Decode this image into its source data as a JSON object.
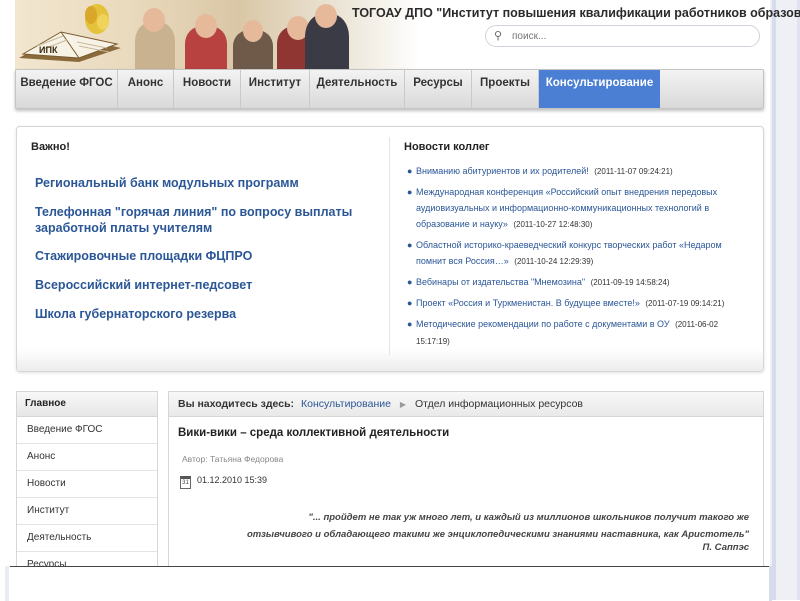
{
  "header": {
    "org_title": "ТОГОАУ ДПО \"Институт повышения квалификации работников образования\"",
    "logo_text": "ИПК"
  },
  "search": {
    "placeholder": "поиск..."
  },
  "nav": {
    "items": [
      {
        "label": "Введение ФГОС",
        "active": false
      },
      {
        "label": "Анонс",
        "active": false
      },
      {
        "label": "Новости",
        "active": false
      },
      {
        "label": "Институт",
        "active": false
      },
      {
        "label": "Деятельность",
        "active": false
      },
      {
        "label": "Ресурсы",
        "active": false
      },
      {
        "label": "Проекты",
        "active": false
      },
      {
        "label": "Консультирование",
        "active": true
      }
    ]
  },
  "important": {
    "title": "Важно!",
    "links": [
      "Региональный банк модульных программ",
      "Телефонная \"горячая линия\" по вопросу выплаты заработной платы учителям",
      "Стажировочные площадки ФЦПРО",
      "Всероссийский интернет-педсовет",
      "Школа губернаторского резерва"
    ]
  },
  "colleague_news": {
    "title": "Новости коллег",
    "items": [
      {
        "text": "Вниманию абитуриентов и их родителей!",
        "date": "(2011-11-07 09:24:21)"
      },
      {
        "text": "Международная конференция «Российский опыт внедрения передовых аудиовизуальных и информационно-коммуникационных технологий в образование и науку»",
        "date": "(2011-10-27 12:48:30)"
      },
      {
        "text": "Областной историко-краеведческий конкурс творческих работ «Недаром помнит вся Россия…»",
        "date": "(2011-10-24 12:29:39)"
      },
      {
        "text": "Вебинары от издательства \"Мнемозина\"",
        "date": "(2011-09-19 14:58:24)"
      },
      {
        "text": "Проект «Россия и Туркменистан. В будущее вместе!»",
        "date": "(2011-07-19 09:14:21)"
      },
      {
        "text": "Методические рекомендации по работе с документами в ОУ",
        "date": "(2011-06-02 15:17:19)"
      }
    ]
  },
  "side_menu": {
    "title": "Главное",
    "items": [
      "Введение ФГОС",
      "Анонс",
      "Новости",
      "Институт",
      "Деятельность",
      "Ресурсы"
    ]
  },
  "breadcrumb": {
    "label": "Вы находитесь здесь:",
    "link": "Консультирование",
    "current": "Отдел информационных ресурсов"
  },
  "article": {
    "title": "Вики-вики – среда коллективной деятельности",
    "author": "Автор: Татьяна Федорова",
    "date": "01.12.2010 15:39",
    "quote_line1": "\"... пройдет не так уж много лет, и каждый из миллионов школьников получит такого же",
    "quote_line2": "отзывчивого и обладающего такими же энциклопедическими знаниями наставника, как Аристотель\"",
    "quote_author": "П. Саппэс"
  },
  "colors": {
    "accent": "#4a7fd3",
    "link": "#2b5797"
  }
}
